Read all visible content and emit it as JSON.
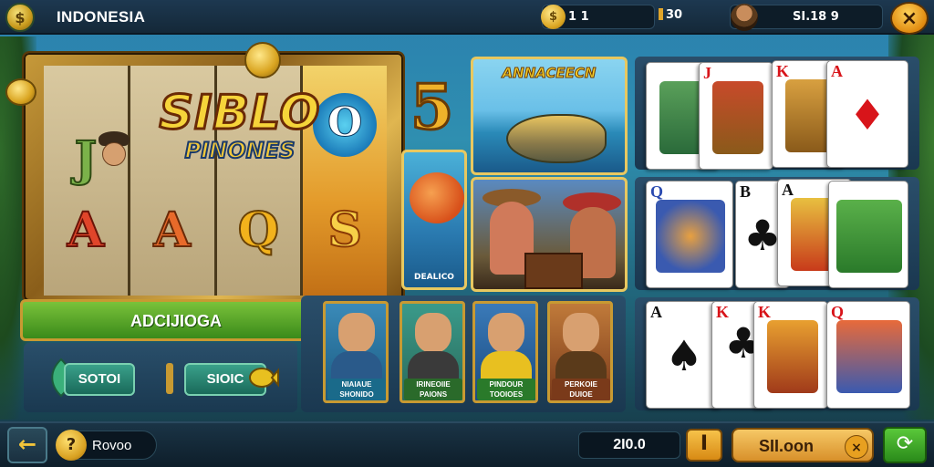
{
  "topbar": {
    "region": "INDONESIA",
    "coins": "1 1",
    "gems": "30",
    "player_balance": "SI.18 9",
    "close_symbol": "×"
  },
  "slot": {
    "logo_line1": "SIBLO",
    "logo_line2": "PINONES",
    "reel_symbols": [
      "J",
      "A",
      "Q",
      "S",
      "O"
    ],
    "bar_label": "ADCIJIOGA",
    "bar_close": "×"
  },
  "left_buttons": {
    "btn1_label": "SOTOI",
    "btn2_label": "SIOIC"
  },
  "middle": {
    "big_number": "5",
    "tile1_title": "ANNACEECN",
    "tile2_caption": "DEALICO",
    "characters": [
      {
        "name": "NIAIAUE\nSHONIDO",
        "color": "#2a8ab8",
        "band": "#1a6a8a"
      },
      {
        "name": "IRINEOIIE\nPAIONS",
        "color": "#3a8a4a",
        "band": "#2a6a2a"
      },
      {
        "name": "PINDOUR\nTOOIOES",
        "color": "#3a6ab0",
        "band": "#2a7a2a"
      },
      {
        "name": "PERKOIE\nDUIOE",
        "color": "#b05a2a",
        "band": "#7a3a1a"
      }
    ]
  },
  "cards": {
    "row1": [
      "J",
      "A",
      "K",
      "A"
    ],
    "row2": [
      "Q",
      "B",
      "A"
    ],
    "row3": [
      "A",
      "K",
      "K",
      "Q"
    ]
  },
  "bottombar": {
    "back_symbol": "←",
    "help_symbol": "?",
    "help_label": "Rovoo",
    "bet_value": "2I0.0",
    "info_symbol": "I",
    "spin_label": "SII.oon",
    "spin_close": "×",
    "refresh_symbol": "⟳"
  }
}
